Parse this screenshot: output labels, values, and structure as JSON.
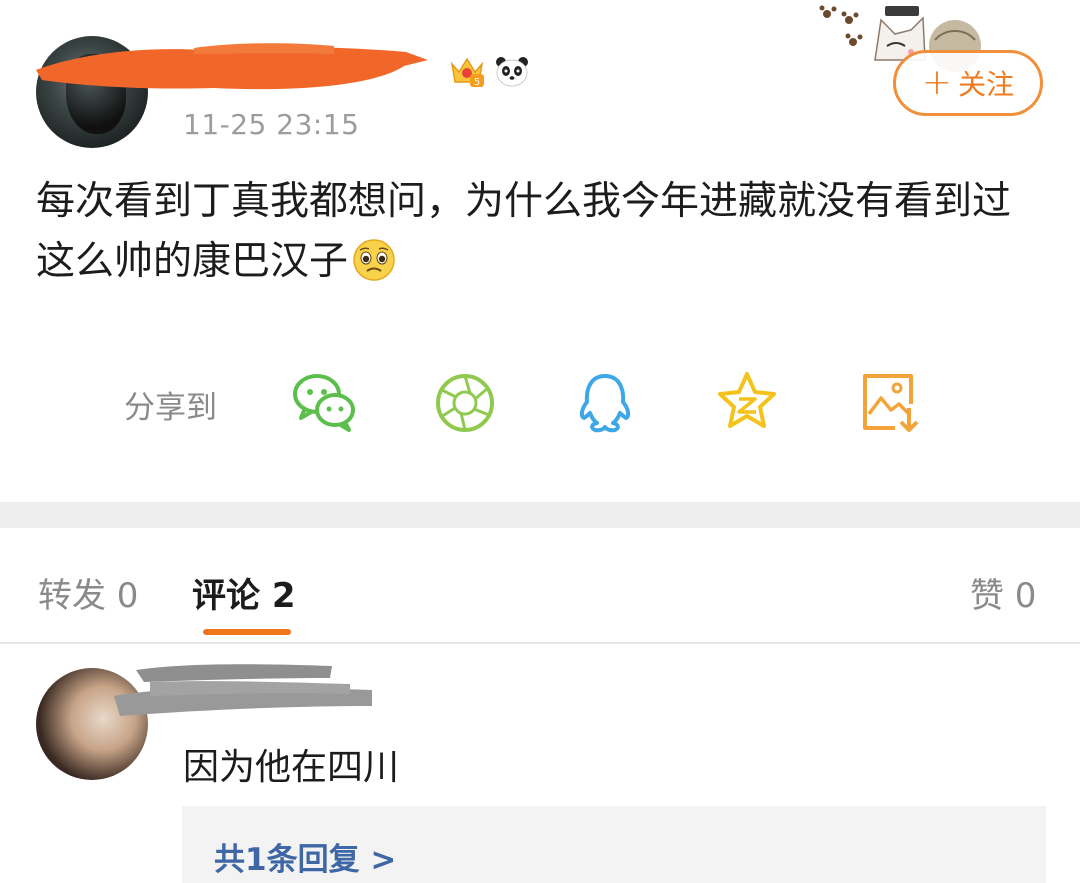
{
  "post": {
    "username_redacted": true,
    "time": "11-25 23:15",
    "follow_label": "关注",
    "follow_icon": "plus-icon",
    "text": "每次看到丁真我都想问，为什么我今年进藏就没有看到过这么帅的康巴汉子",
    "emoji": "pleading-face-emoji",
    "badges": [
      "crown-level-badge",
      "panda-badge"
    ],
    "crown_level": "5"
  },
  "share": {
    "label": "分享到",
    "targets": [
      {
        "name": "wechat",
        "icon": "wechat-icon",
        "color": "#5cbf4c"
      },
      {
        "name": "moments",
        "icon": "moments-icon",
        "color": "#8fca4f"
      },
      {
        "name": "qq",
        "icon": "qq-icon",
        "color": "#3da7e8"
      },
      {
        "name": "qzone",
        "icon": "qzone-icon",
        "color": "#f5c21b"
      },
      {
        "name": "save-image",
        "icon": "save-image-icon",
        "color": "#f2a43a"
      }
    ]
  },
  "tabs": {
    "repost": "转发 0",
    "comments": "评论 2",
    "likes": "赞 0",
    "active_color": "#f0761d"
  },
  "comment": {
    "username_redacted": true,
    "text": "因为他在四川",
    "replies_link": "共1条回复 >"
  }
}
